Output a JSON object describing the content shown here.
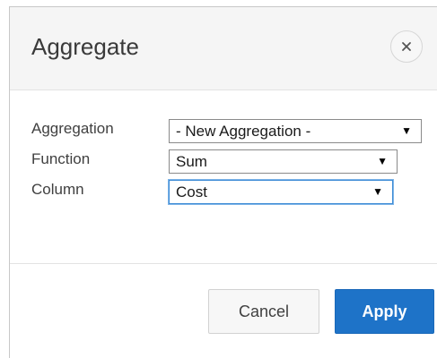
{
  "dialog": {
    "title": "Aggregate",
    "close_icon": "close-icon"
  },
  "form": {
    "aggregation": {
      "label": "Aggregation",
      "value": "- New Aggregation -"
    },
    "function": {
      "label": "Function",
      "value": "Sum"
    },
    "column": {
      "label": "Column",
      "value": "Cost"
    },
    "dropdown_arrow": "▼"
  },
  "footer": {
    "cancel_label": "Cancel",
    "apply_label": "Apply"
  },
  "colors": {
    "header_background": "#f5f5f5",
    "primary_button": "#1e73c8",
    "focus_ring": "#3d8cd6"
  }
}
